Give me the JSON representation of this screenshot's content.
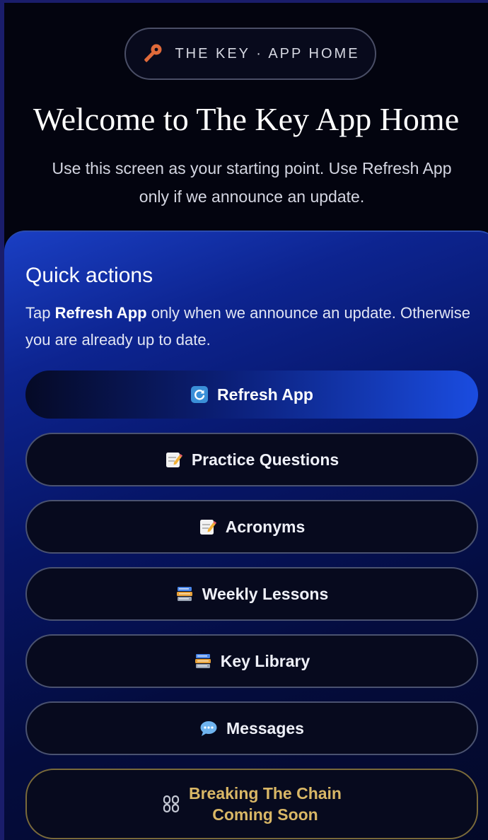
{
  "badge": {
    "icon": "key-icon",
    "text": "THE KEY · APP HOME"
  },
  "title": "Welcome to The Key App Home",
  "subtitle": {
    "line1": "Use this screen as your starting point. Use Refresh App",
    "line2": "only if we announce an update."
  },
  "quick_actions": {
    "title": "Quick actions",
    "desc_pre": "Tap ",
    "desc_bold": "Refresh App",
    "desc_post": " only when we announce an update. Otherwise you are already up to date.",
    "buttons": [
      {
        "label": "Refresh App",
        "icon": "refresh-icon"
      },
      {
        "label": "Practice Questions",
        "icon": "memo-icon"
      },
      {
        "label": "Acronyms",
        "icon": "memo-icon"
      },
      {
        "label": "Weekly Lessons",
        "icon": "books-icon"
      },
      {
        "label": "Key Library",
        "icon": "books-icon"
      },
      {
        "label": "Messages",
        "icon": "speech-bubble-icon"
      },
      {
        "label_line1": "Breaking The Chain",
        "label_line2": "Coming Soon",
        "icon": "chain-icon"
      }
    ]
  },
  "colors": {
    "background": "#03040f",
    "accent": "#1a4ce0",
    "gold": "#d9b766",
    "key_icon": "#e06a3a"
  }
}
